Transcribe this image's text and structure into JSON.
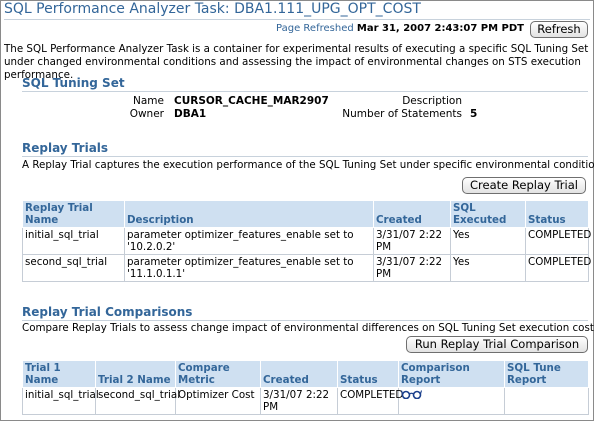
{
  "header": {
    "title": "SQL Performance Analyzer Task: DBA1.111_UPG_OPT_COST",
    "refreshed_label": "Page Refreshed",
    "refreshed_value": "Mar 31, 2007 2:43:07 PM PDT",
    "refresh_button": "Refresh"
  },
  "description": "The SQL Performance Analyzer Task is a container for experimental results of executing a specific SQL Tuning Set under changed environmental conditions and assessing the impact of environmental changes on STS execution performance.",
  "tuning_set": {
    "heading": "SQL Tuning Set",
    "name_label": "Name",
    "name_value": "CURSOR_CACHE_MAR2907",
    "owner_label": "Owner",
    "owner_value": "DBA1",
    "description_label": "Description",
    "description_value": "",
    "statements_label": "Number of Statements",
    "statements_value": "5"
  },
  "replay_trials": {
    "heading": "Replay Trials",
    "description": "A Replay Trial captures the execution performance of the SQL Tuning Set under specific environmental conditions.",
    "create_button": "Create Replay Trial",
    "columns": [
      "Replay Trial Name",
      "Description",
      "Created",
      "SQL Executed",
      "Status"
    ],
    "rows": [
      {
        "name": "initial_sql_trial",
        "description": "parameter optimizer_features_enable set to '10.2.0.2'",
        "created": "3/31/07 2:22 PM",
        "executed": "Yes",
        "status": "COMPLETED"
      },
      {
        "name": "second_sql_trial",
        "description": "parameter optimizer_features_enable set to '11.1.0.1.1'",
        "created": "3/31/07 2:22 PM",
        "executed": "Yes",
        "status": "COMPLETED"
      }
    ]
  },
  "comparisons": {
    "heading": "Replay Trial Comparisons",
    "description": "Compare Replay Trials to assess change impact of environmental differences on SQL Tuning Set execution costs.",
    "run_button": "Run Replay Trial Comparison",
    "columns": [
      "Trial 1 Name",
      "Trial 2 Name",
      "Compare Metric",
      "Created",
      "Status",
      "Comparison Report",
      "SQL Tune Report"
    ],
    "rows": [
      {
        "trial1": "initial_sql_trial",
        "trial2": "second_sql_trial",
        "metric": "Optimizer Cost",
        "created": "3/31/07 2:22 PM",
        "status": "COMPLETED",
        "report_icon": "glasses-icon",
        "tune_report": ""
      }
    ]
  }
}
